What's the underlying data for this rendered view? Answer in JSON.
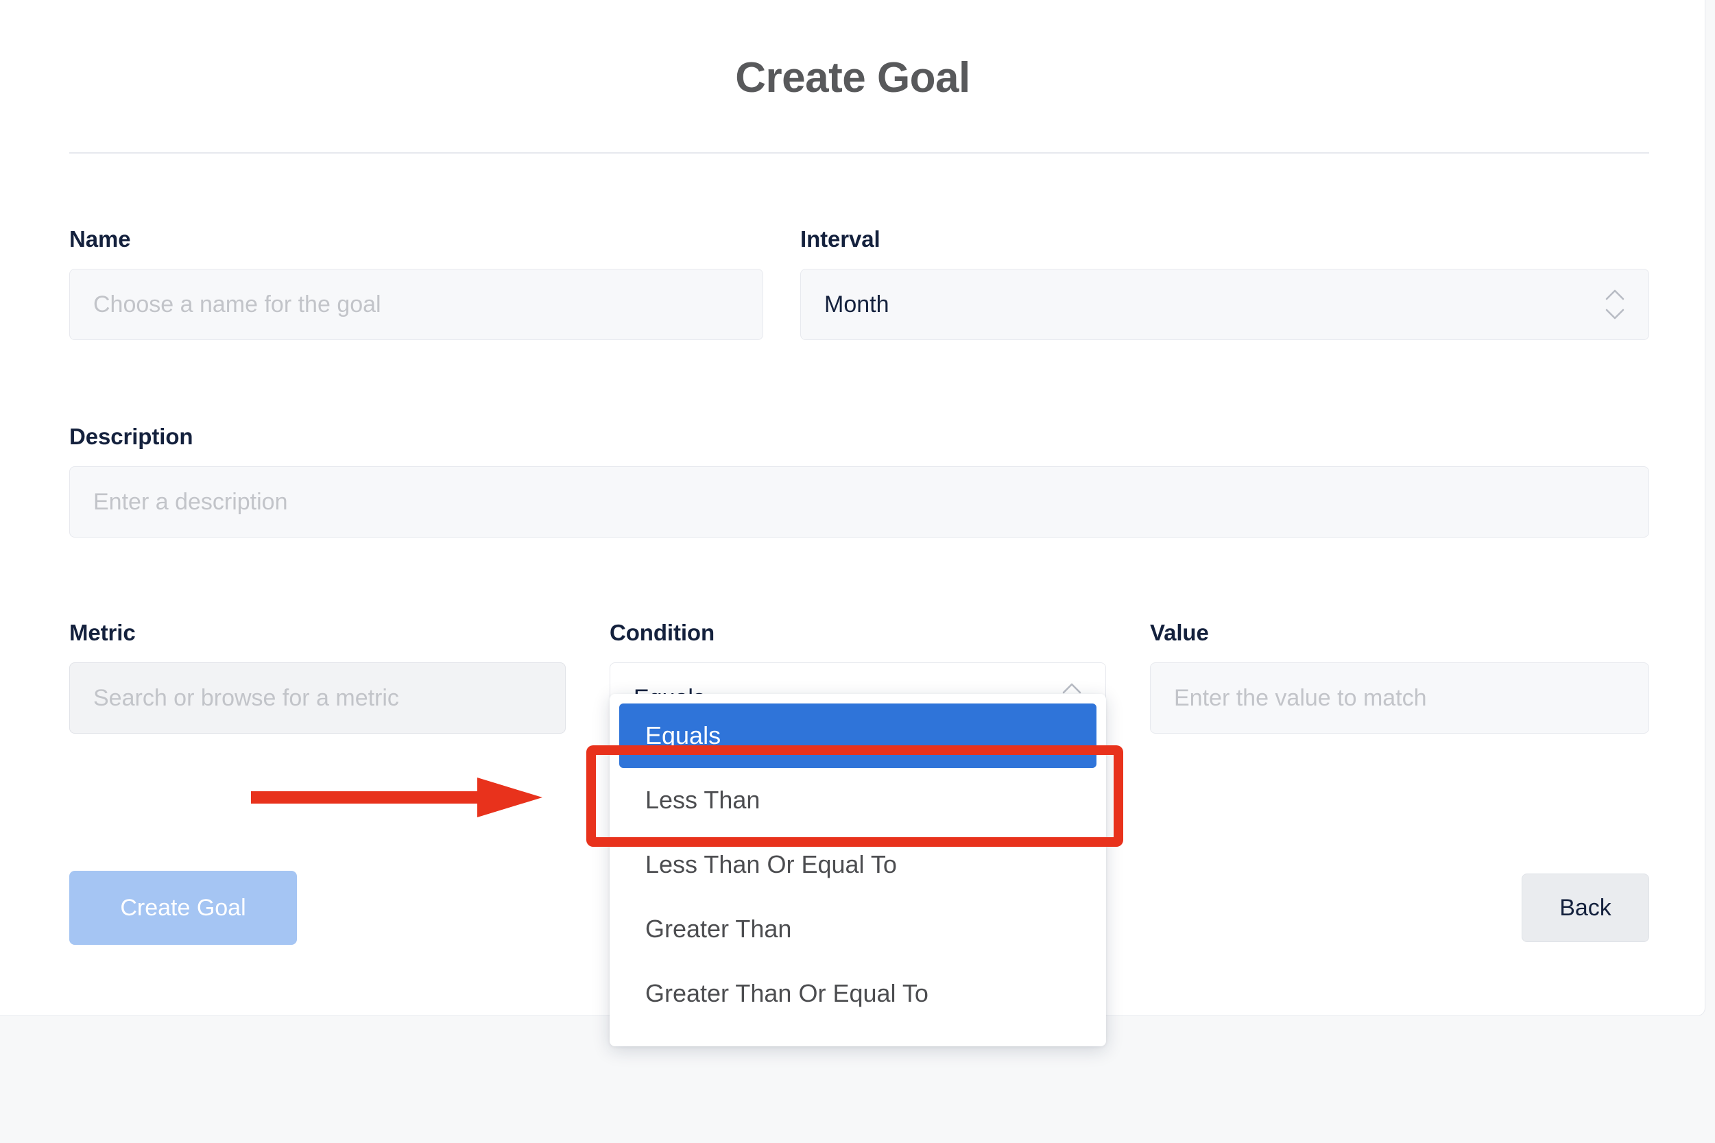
{
  "header": {
    "title": "Create Goal"
  },
  "form": {
    "name": {
      "label": "Name",
      "placeholder": "Choose a name for the goal",
      "value": ""
    },
    "interval": {
      "label": "Interval",
      "value": "Month"
    },
    "description": {
      "label": "Description",
      "placeholder": "Enter a description",
      "value": ""
    },
    "metric": {
      "label": "Metric",
      "placeholder": "Search or browse for a metric",
      "value": ""
    },
    "condition": {
      "label": "Condition",
      "value": "Equals",
      "options": [
        "Equals",
        "Less Than",
        "Less Than Or Equal To",
        "Greater Than",
        "Greater Than Or Equal To"
      ],
      "selected_index": 0
    },
    "value": {
      "label": "Value",
      "placeholder": "Enter the value to match",
      "value": ""
    }
  },
  "actions": {
    "create_label": "Create Goal",
    "back_label": "Back"
  },
  "annotation": {
    "color": "#e8321c",
    "arrow": "right-arrow",
    "target": "Equals"
  },
  "colors": {
    "title": "#58595b",
    "label": "#14213d",
    "placeholder": "#c2c4c9",
    "selected_option_bg": "#2f74d9",
    "create_button_bg": "#a5c5f3",
    "back_button_bg": "#eaecef",
    "card_bg": "#ffffff",
    "page_bg": "#f7f8f9",
    "input_bg": "#f7f8fa",
    "border": "#e7e9ee"
  }
}
